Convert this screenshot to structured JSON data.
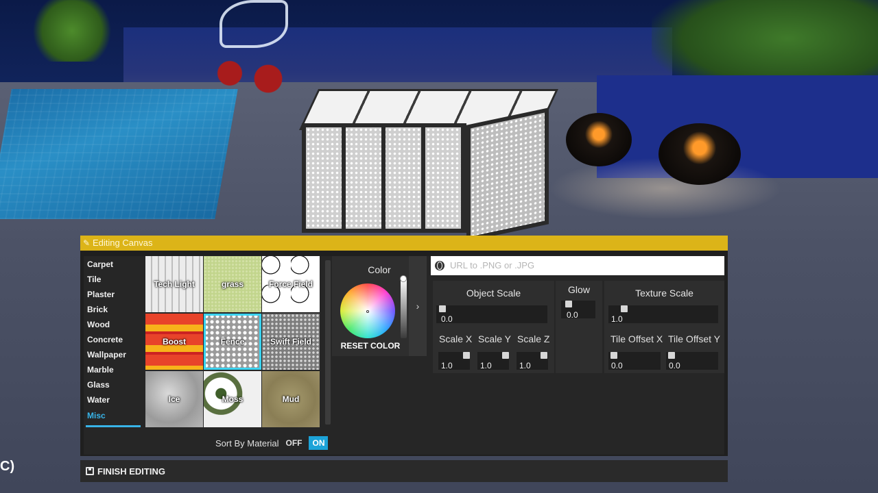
{
  "scene": {
    "partial_left_label": "C)"
  },
  "panel": {
    "title": "Editing Canvas",
    "categories": [
      {
        "label": "Carpet",
        "active": false
      },
      {
        "label": "Tile",
        "active": false
      },
      {
        "label": "Plaster",
        "active": false
      },
      {
        "label": "Brick",
        "active": false
      },
      {
        "label": "Wood",
        "active": false
      },
      {
        "label": "Concrete",
        "active": false
      },
      {
        "label": "Wallpaper",
        "active": false
      },
      {
        "label": "Marble",
        "active": false
      },
      {
        "label": "Glass",
        "active": false
      },
      {
        "label": "Water",
        "active": false
      },
      {
        "label": "Misc",
        "active": true
      }
    ],
    "textures": [
      {
        "label": "Tech Light",
        "selected": false
      },
      {
        "label": "grass",
        "selected": false
      },
      {
        "label": "Force Field",
        "selected": false
      },
      {
        "label": "Boost",
        "selected": false
      },
      {
        "label": "Fence",
        "selected": true
      },
      {
        "label": "Swift Field",
        "selected": false
      },
      {
        "label": "Ice",
        "selected": false
      },
      {
        "label": "Moss",
        "selected": false
      },
      {
        "label": "Mud",
        "selected": false
      }
    ],
    "sort": {
      "label": "Sort By Material",
      "off_label": "OFF",
      "on_label": "ON",
      "value": "ON"
    },
    "color": {
      "title": "Color",
      "reset_label": "RESET COLOR",
      "brightness": 1.0
    },
    "url": {
      "placeholder": "URL to .PNG or .JPG",
      "value": ""
    },
    "object_scale": {
      "title": "Object Scale",
      "value": "0.0",
      "x_label": "Scale X",
      "x_value": "1.0",
      "y_label": "Scale Y",
      "y_value": "1.0",
      "z_label": "Scale Z",
      "z_value": "1.0"
    },
    "glow": {
      "title": "Glow",
      "value": "0.0"
    },
    "texture_scale": {
      "title": "Texture Scale",
      "value": "1.0",
      "offset_x_label": "Tile Offset X",
      "offset_x_value": "0.0",
      "offset_y_label": "Tile Offset Y",
      "offset_y_value": "0.0"
    },
    "finish_label": "FINISH EDITING"
  },
  "colors": {
    "title_bar": "#dcb418",
    "accent": "#38b4e8",
    "toggle_on": "#1ca3d8",
    "selected_outline": "#3bd3f0"
  }
}
